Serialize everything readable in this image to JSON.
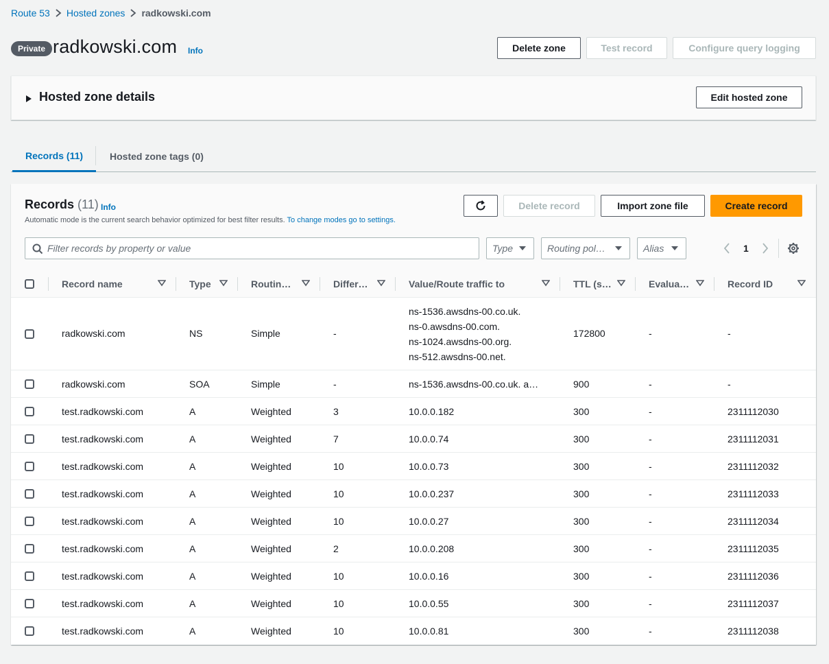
{
  "breadcrumb": {
    "items": [
      "Route 53",
      "Hosted zones"
    ],
    "current": "radkowski.com"
  },
  "header": {
    "badge": "Private",
    "title": "radkowski.com",
    "info": "Info",
    "buttons": {
      "delete_zone": "Delete zone",
      "test_record": "Test record",
      "configure_query_logging": "Configure query logging"
    }
  },
  "details": {
    "title": "Hosted zone details",
    "edit_button": "Edit hosted zone"
  },
  "tabs": [
    {
      "label": "Records (11)",
      "active": true
    },
    {
      "label": "Hosted zone tags (0)",
      "active": false
    }
  ],
  "records": {
    "title": "Records",
    "count": "(11)",
    "info": "Info",
    "description": "Automatic mode is the current search behavior optimized for best filter results.",
    "description_link": "To change modes go to settings.",
    "buttons": {
      "delete_record": "Delete record",
      "import_zone_file": "Import zone file",
      "create_record": "Create record"
    },
    "filter_placeholder": "Filter records by property or value",
    "selects": {
      "type": "Type",
      "routing_policy": "Routing pol…",
      "alias": "Alias"
    },
    "page": "1",
    "columns": [
      "Record name",
      "Type",
      "Routin…",
      "Differ…",
      "Value/Route traffic to",
      "TTL (s…",
      "Evalua…",
      "Record ID"
    ],
    "rows": [
      {
        "name": "radkowski.com",
        "type": "NS",
        "routing": "Simple",
        "diff": "-",
        "values": [
          "ns-1536.awsdns-00.co.uk.",
          "ns-0.awsdns-00.com.",
          "ns-1024.awsdns-00.org.",
          "ns-512.awsdns-00.net."
        ],
        "ttl": "172800",
        "eval": "-",
        "id": "-"
      },
      {
        "name": "radkowski.com",
        "type": "SOA",
        "routing": "Simple",
        "diff": "-",
        "values": [
          "ns-1536.awsdns-00.co.uk. a…"
        ],
        "ttl": "900",
        "eval": "-",
        "id": "-"
      },
      {
        "name": "test.radkowski.com",
        "type": "A",
        "routing": "Weighted",
        "diff": "3",
        "values": [
          "10.0.0.182"
        ],
        "ttl": "300",
        "eval": "-",
        "id": "2311112030"
      },
      {
        "name": "test.radkowski.com",
        "type": "A",
        "routing": "Weighted",
        "diff": "7",
        "values": [
          "10.0.0.74"
        ],
        "ttl": "300",
        "eval": "-",
        "id": "2311112031"
      },
      {
        "name": "test.radkowski.com",
        "type": "A",
        "routing": "Weighted",
        "diff": "10",
        "values": [
          "10.0.0.73"
        ],
        "ttl": "300",
        "eval": "-",
        "id": "2311112032"
      },
      {
        "name": "test.radkowski.com",
        "type": "A",
        "routing": "Weighted",
        "diff": "10",
        "values": [
          "10.0.0.237"
        ],
        "ttl": "300",
        "eval": "-",
        "id": "2311112033"
      },
      {
        "name": "test.radkowski.com",
        "type": "A",
        "routing": "Weighted",
        "diff": "10",
        "values": [
          "10.0.0.27"
        ],
        "ttl": "300",
        "eval": "-",
        "id": "2311112034"
      },
      {
        "name": "test.radkowski.com",
        "type": "A",
        "routing": "Weighted",
        "diff": "2",
        "values": [
          "10.0.0.208"
        ],
        "ttl": "300",
        "eval": "-",
        "id": "2311112035"
      },
      {
        "name": "test.radkowski.com",
        "type": "A",
        "routing": "Weighted",
        "diff": "10",
        "values": [
          "10.0.0.16"
        ],
        "ttl": "300",
        "eval": "-",
        "id": "2311112036"
      },
      {
        "name": "test.radkowski.com",
        "type": "A",
        "routing": "Weighted",
        "diff": "10",
        "values": [
          "10.0.0.55"
        ],
        "ttl": "300",
        "eval": "-",
        "id": "2311112037"
      },
      {
        "name": "test.radkowski.com",
        "type": "A",
        "routing": "Weighted",
        "diff": "10",
        "values": [
          "10.0.0.81"
        ],
        "ttl": "300",
        "eval": "-",
        "id": "2311112038"
      }
    ]
  },
  "colors": {
    "link": "#0073bb",
    "primary_button": "#ff9900",
    "badge": "#545b64",
    "page_bg": "#f2f3f3"
  },
  "icons": [
    "chevron-right-icon",
    "caret-right-icon",
    "refresh-icon",
    "search-icon",
    "dropdown-triangle-icon",
    "chevron-left-icon",
    "gear-icon",
    "sort-icon"
  ]
}
